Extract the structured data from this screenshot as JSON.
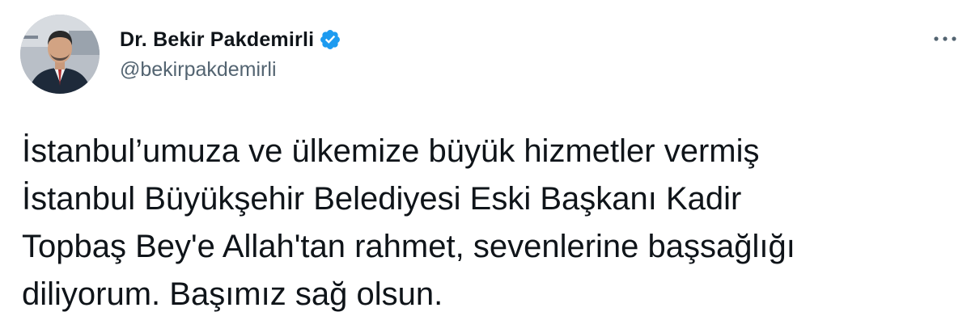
{
  "author": {
    "display_name": "Dr. Bekir Pakdemirli",
    "handle": "@bekirpakdemirli",
    "verified": true,
    "avatar_icon": "profile-photo"
  },
  "menu": {
    "icon": "more-horizontal-icon"
  },
  "tweet": {
    "lines": [
      "İstanbul’umuza ve ülkemize büyük hizmetler vermiş",
      "İstanbul Büyükşehir Belediyesi Eski Başkanı Kadir",
      "Topbaş Bey'e Allah'tan rahmet, sevenlerine başsağlığı",
      "diliyorum. Başımız sağ olsun."
    ]
  },
  "colors": {
    "text": "#0f1419",
    "secondary": "#536471",
    "verified_blue": "#1d9bf0"
  }
}
